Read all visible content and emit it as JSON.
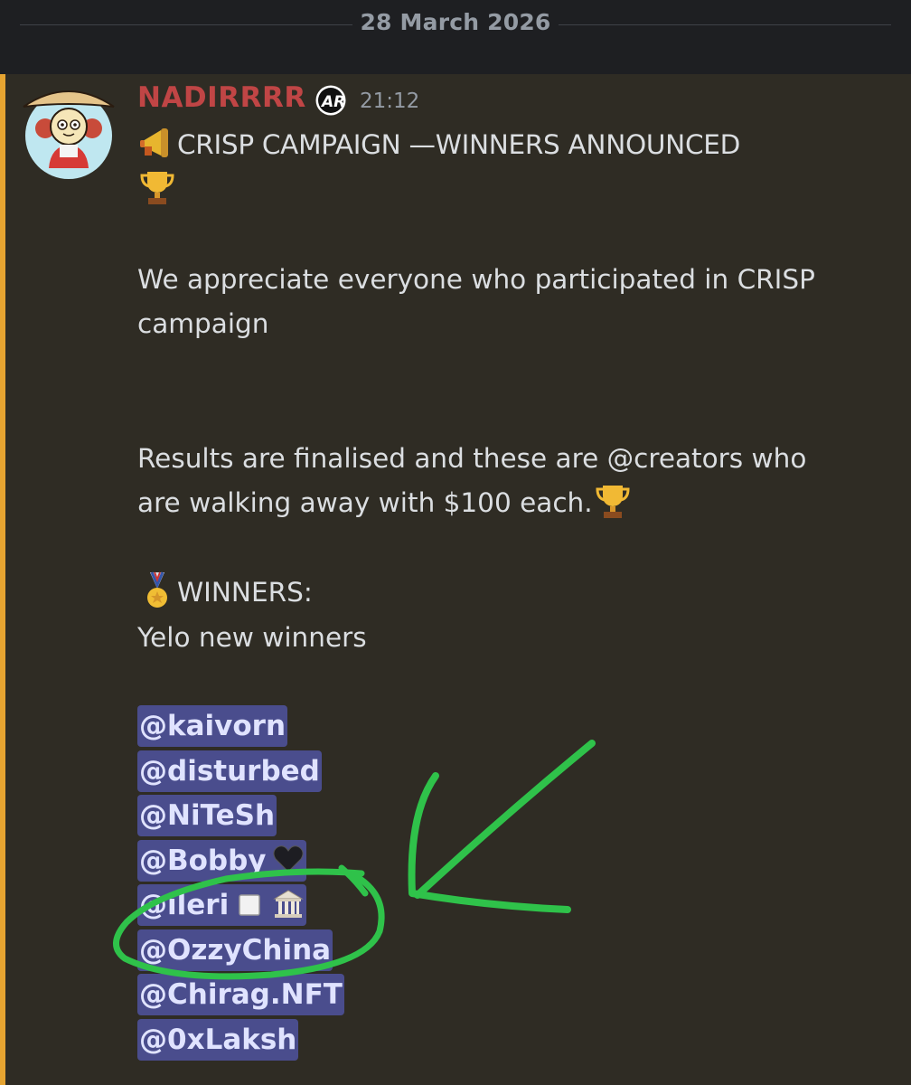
{
  "date_divider": "28 March 2026",
  "message": {
    "author": "NADIRRRR",
    "timestamp": "21:12",
    "title": "CRISP CAMPAIGN —WINNERS ANNOUNCED",
    "line_appreciate_1": "We appreciate everyone who participated in CRISP",
    "line_appreciate_2": "campaign",
    "line_results_1": "Results are finalised and these are @creators who",
    "line_results_2": "are walking away with $100 each.",
    "winners_heading": "WINNERS:",
    "winners_sub": "Yelo new winners",
    "mentions": [
      "@kaivorn",
      "@disturbed",
      "@NiTeSh",
      "@Bobby",
      "@ileri",
      "@OzzyChina",
      "@Chirag.NFT",
      "@0xLaksh"
    ]
  },
  "colors": {
    "accent_bar": "#e6a431",
    "username": "#c04545",
    "mention_bg": "#4a4d8d",
    "annotation": "#2fc24a"
  },
  "icons": {
    "badge": "ar-badge-icon",
    "megaphone": "megaphone-icon",
    "trophy": "trophy-icon",
    "medal": "medal-icon",
    "black_heart": "black-heart-icon",
    "white_square": "white-square-icon",
    "classical_building": "classical-building-icon"
  }
}
